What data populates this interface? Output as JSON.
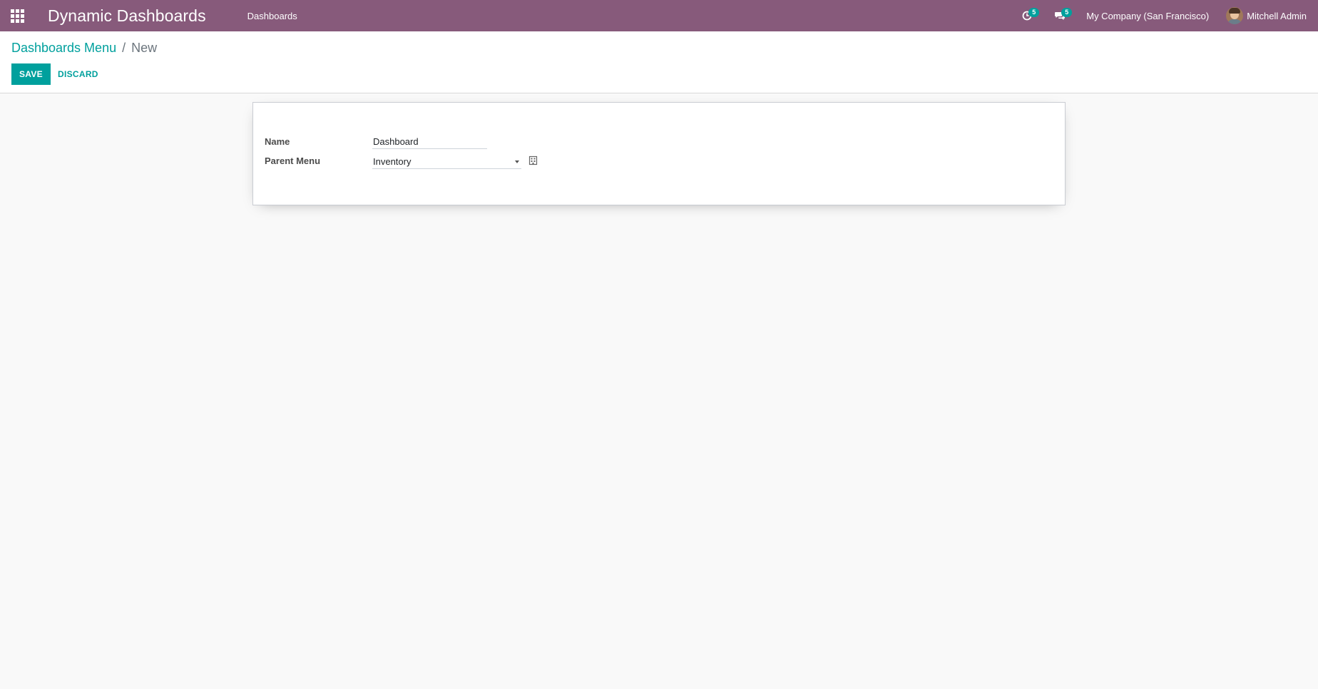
{
  "navbar": {
    "app_title": "Dynamic Dashboards",
    "menu_item": "Dashboards",
    "activity_count": "5",
    "messages_count": "5",
    "company": "My Company (San Francisco)",
    "user_name": "Mitchell Admin",
    "background_color": "#875a7b",
    "badge_color": "#00a09d"
  },
  "breadcrumb": {
    "parent": "Dashboards Menu",
    "separator": "/",
    "current": "New"
  },
  "actions": {
    "save_label": "SAVE",
    "discard_label": "DISCARD",
    "primary_color": "#00a09d"
  },
  "form": {
    "name_label": "Name",
    "name_value": "Dashboard",
    "parent_label": "Parent Menu",
    "parent_value": "Inventory"
  },
  "icons": {
    "apps": "apps-grid-icon",
    "activity": "clock-icon",
    "messages": "chat-icon",
    "dropdown": "caret-down-icon",
    "external": "external-link-icon"
  }
}
